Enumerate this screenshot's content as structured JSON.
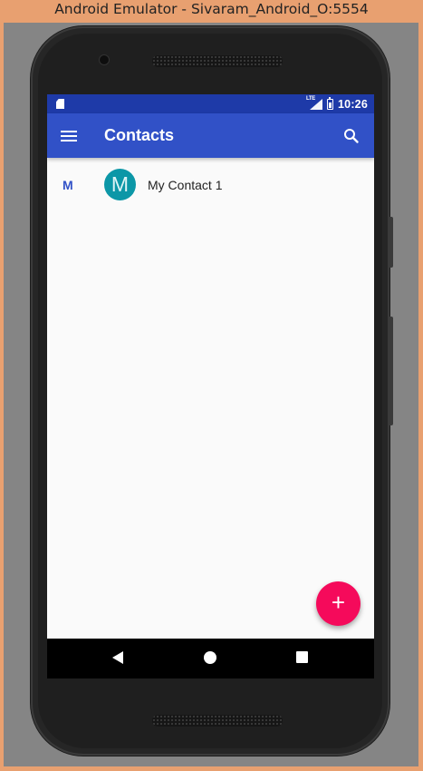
{
  "window": {
    "title": "Android Emulator - Sivaram_Android_O:5554"
  },
  "status_bar": {
    "time": "10:26",
    "network": "LTE",
    "icons": [
      "sim-card-icon",
      "lte-signal-icon",
      "battery-icon"
    ]
  },
  "app_bar": {
    "title": "Contacts",
    "menu_icon": "hamburger-menu-icon",
    "search_icon": "search-icon"
  },
  "contacts": [
    {
      "section": "M",
      "initial": "M",
      "name": "My Contact 1",
      "avatar_color": "#0c97a7"
    }
  ],
  "fab": {
    "symbol": "+",
    "color": "#f50a5b"
  },
  "nav_bar": {
    "icons": [
      "back-icon",
      "home-icon",
      "recents-icon"
    ]
  },
  "colors": {
    "primary": "#3151c7",
    "status_bar": "#1e3aa8",
    "accent": "#f50a5b"
  }
}
